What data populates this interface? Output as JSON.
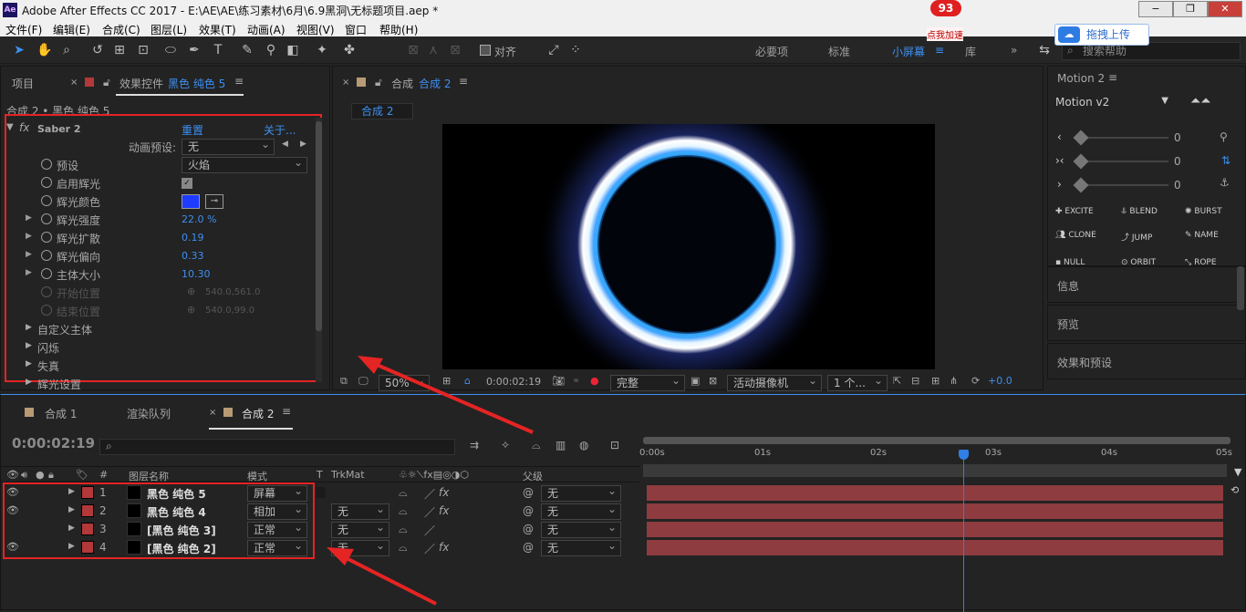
{
  "window": {
    "title": "Adobe After Effects CC 2017 - E:\\AE\\AE\\练习素材\\6月\\6.9黑洞\\无标题项目.aep *",
    "logo": "Ae",
    "badge": "93",
    "badge_caption": "点我加速",
    "upload": "拖拽上传",
    "min": "−",
    "max": "❐",
    "close": "✕"
  },
  "menu": [
    "文件(F)",
    "编辑(E)",
    "合成(C)",
    "图层(L)",
    "效果(T)",
    "动画(A)",
    "视图(V)",
    "窗口",
    "帮助(H)"
  ],
  "toolbar": {
    "align_label": "对齐",
    "workspaces": [
      "必要项",
      "标准",
      "小屏幕",
      "库"
    ],
    "active_workspace": "小屏幕",
    "search_placeholder": "搜索帮助"
  },
  "effects_panel": {
    "tab_project": "项目",
    "tab_effects": "效果控件",
    "tab_effects_target": "黑色 纯色 5",
    "breadcrumb": "合成 2 • 黑色 纯色 5",
    "effect_name": "Saber 2",
    "reset": "重置",
    "about": "关于...",
    "preset_anim_label": "动画预设:",
    "preset_anim_value": "无",
    "props": [
      {
        "name": "预设",
        "value": "火焰",
        "type": "dropdown"
      },
      {
        "name": "启用辉光",
        "value": "✓",
        "type": "check"
      },
      {
        "name": "辉光颜色",
        "value": "",
        "type": "color"
      },
      {
        "name": "辉光强度",
        "value": "22.0 %",
        "type": "num"
      },
      {
        "name": "辉光扩散",
        "value": "0.19",
        "type": "num"
      },
      {
        "name": "辉光偏向",
        "value": "0.33",
        "type": "num"
      },
      {
        "name": "主体大小",
        "value": "10.30",
        "type": "num"
      },
      {
        "name": "开始位置",
        "value": "540.0,561.0",
        "type": "disabled"
      },
      {
        "name": "结束位置",
        "value": "540.0,99.0",
        "type": "disabled"
      }
    ],
    "groups": [
      "自定义主体",
      "闪烁",
      "失真",
      "辉光设置"
    ]
  },
  "comp_panel": {
    "tab_label": "合成",
    "tab_name": "合成 2",
    "subtab": "合成 2",
    "zoom": "50%",
    "timecode": "0:00:02:19",
    "resolution": "完整",
    "camera": "活动摄像机",
    "views": "1 个...",
    "exposure": "+0.0"
  },
  "motion_panel": {
    "title": "Motion 2",
    "version": "Motion v2",
    "sliders": [
      {
        "value": "0"
      },
      {
        "value": "0"
      },
      {
        "value": "0"
      }
    ],
    "buttons": [
      "EXCITE",
      "BLEND",
      "BURST",
      "CLONE",
      "JUMP",
      "NAME",
      "NULL",
      "ORBIT",
      "ROPE"
    ],
    "sections": [
      "信息",
      "预览",
      "效果和预设"
    ]
  },
  "timeline": {
    "tabs": [
      "合成 1",
      "渲染队列",
      "合成 2"
    ],
    "timecode": "0:00:02:19",
    "search_placeholder": "",
    "columns": {
      "num": "#",
      "name": "图层名称",
      "mode": "模式",
      "t": "T",
      "trkmat": "TrkMat",
      "parent": "父级"
    },
    "ruler": [
      "0:00s",
      "01s",
      "02s",
      "03s",
      "04s",
      "05s"
    ],
    "layers": [
      {
        "num": "1",
        "name": "黑色 纯色 5",
        "mode": "屏幕",
        "trkmat": "",
        "parent": "无"
      },
      {
        "num": "2",
        "name": "黑色 纯色 4",
        "mode": "相加",
        "trkmat": "无",
        "parent": "无"
      },
      {
        "num": "3",
        "name": "[黑色 纯色 3]",
        "mode": "正常",
        "trkmat": "无",
        "parent": "无"
      },
      {
        "num": "4",
        "name": "[黑色 纯色 2]",
        "mode": "正常",
        "trkmat": "无",
        "parent": "无"
      }
    ],
    "playhead_fraction": 0.55
  },
  "colors": {
    "accent": "#3d8ff0",
    "highlight": "#e52424",
    "layer_bar": "#8e3c3f",
    "glow_color": "#1d3cff"
  }
}
